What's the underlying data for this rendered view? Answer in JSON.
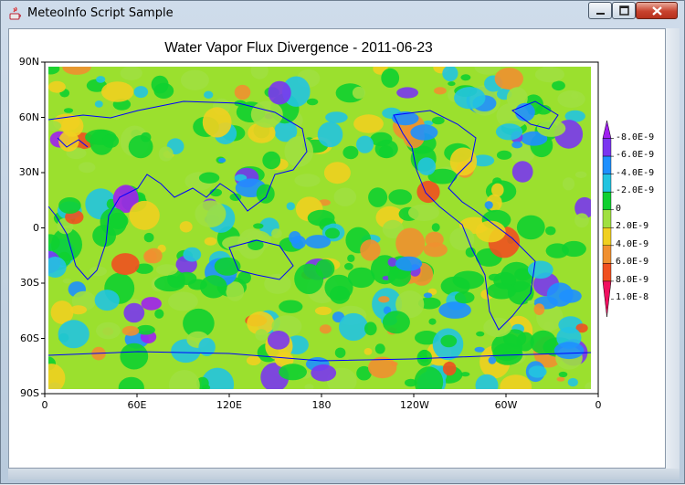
{
  "window": {
    "title": "MeteoInfo Script Sample"
  },
  "chart_data": {
    "type": "heatmap",
    "title": "Water Vapor Flux Divergence - 2011-06-23",
    "xlabel": "",
    "ylabel": "",
    "x_ticks": [
      "0",
      "60E",
      "120E",
      "180",
      "120W",
      "60W",
      "0"
    ],
    "y_ticks": [
      "90N",
      "60N",
      "30N",
      "0",
      "30S",
      "60S",
      "90S"
    ],
    "xlim": [
      0,
      360
    ],
    "ylim": [
      -90,
      90
    ],
    "legend_placement": "right",
    "legend": [
      "-8.0E-9",
      "-6.0E-9",
      "-4.0E-9",
      "-2.0E-9",
      "0",
      "2.0E-9",
      "4.0E-9",
      "6.0E-9",
      "8.0E-9",
      "1.0E-8"
    ],
    "colors": [
      "#a020f0",
      "#7a36f0",
      "#1e90ff",
      "#22c4e0",
      "#10d030",
      "#a0e040",
      "#f0d020",
      "#f09030",
      "#f05020",
      "#f01060"
    ],
    "coastline_color": "#0000ff"
  }
}
